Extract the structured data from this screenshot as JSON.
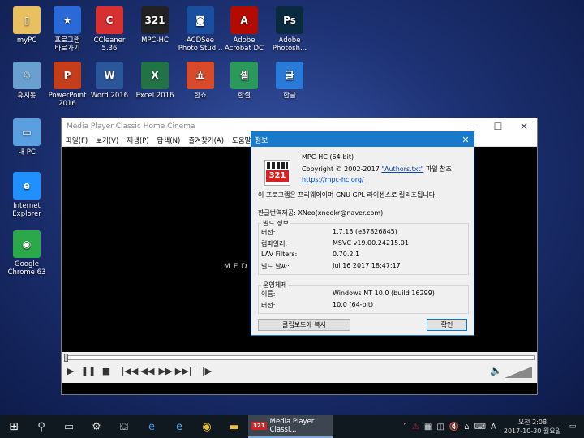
{
  "desktop_icons": [
    {
      "label": "myPC",
      "color": "#e8c060",
      "glyph": "▯"
    },
    {
      "label": "프로그램\n바로가기",
      "color": "#2a6ad8",
      "glyph": "★"
    },
    {
      "label": "CCleaner\n5.36",
      "color": "#d63030",
      "glyph": "C"
    },
    {
      "label": "MPC-HC",
      "color": "#222222",
      "glyph": "321"
    },
    {
      "label": "ACDSee\nPhoto Stud...",
      "color": "#1a4fa0",
      "glyph": "◙"
    },
    {
      "label": "Adobe\nAcrobat DC",
      "color": "#b30b00",
      "glyph": "A"
    },
    {
      "label": "Adobe\nPhotosh...",
      "color": "#0a2a40",
      "glyph": "Ps"
    },
    {
      "label": "휴지통",
      "color": "#6aa0d0",
      "glyph": "♲"
    },
    {
      "label": "PowerPoint\n2016",
      "color": "#c43e1c",
      "glyph": "P"
    },
    {
      "label": "Word 2016",
      "color": "#2b579a",
      "glyph": "W"
    },
    {
      "label": "Excel 2016",
      "color": "#217346",
      "glyph": "X"
    },
    {
      "label": "한쇼",
      "color": "#d84a2a",
      "glyph": "쇼"
    },
    {
      "label": "한셀",
      "color": "#2a9a5a",
      "glyph": "셀"
    },
    {
      "label": "한글",
      "color": "#2a7ad8",
      "glyph": "글"
    },
    {
      "label": "내 PC",
      "color": "#5aa0e0",
      "glyph": "▭"
    },
    {
      "label": "Internet\nExplorer",
      "color": "#1e90ff",
      "glyph": "e"
    },
    {
      "label": "Google\nChrome 63",
      "color": "#2aa84a",
      "glyph": "◉"
    }
  ],
  "mpc": {
    "title": "Media Player Classic Home Cinema",
    "menu": [
      "파일(F)",
      "보기(V)",
      "재생(P)",
      "탐색(N)",
      "즐겨찾기(A)",
      "도움말"
    ],
    "video_text": "MEDI",
    "controls": [
      "▶",
      "❚❚",
      "■",
      "|◀◀",
      "◀◀",
      "▶▶",
      "▶▶|",
      "|▶"
    ],
    "volume_icon": "🔈"
  },
  "about": {
    "title": "정보",
    "app_name": "MPC-HC (64-bit)",
    "copyright_prefix": "Copyright © 2002-2017 ",
    "authors_link": "\"Authors.txt\"",
    "copyright_suffix": " 파일 참조",
    "website": "https://mpc-hc.org/",
    "license_text": "이 프로그램은 프리웨어이며 GNU GPL 라이센스로 릴리즈됩니다.",
    "translator": "한글번역제공: XNeo(xneokr@naver.com)",
    "build_group": "빌드 정보",
    "build_rows": [
      {
        "k": "버전:",
        "v": "1.7.13 (e37826845)"
      },
      {
        "k": "컴파일러:",
        "v": "MSVC v19.00.24215.01"
      },
      {
        "k": "LAV Filters:",
        "v": "0.70.2.1"
      },
      {
        "k": "빌드 날짜:",
        "v": "Jul 16 2017 18:47:17"
      }
    ],
    "os_group": "운영체제",
    "os_rows": [
      {
        "k": "이름:",
        "v": "Windows NT 10.0 (build 16299)"
      },
      {
        "k": "버전:",
        "v": "10.0 (64-bit)"
      }
    ],
    "copy_button": "클립보드에 복사",
    "ok_button": "확인"
  },
  "taskbar": {
    "active_window": "Media Player Classi...",
    "clock_time": "오전 2:08",
    "clock_date": "2017-10-30 월요일"
  }
}
